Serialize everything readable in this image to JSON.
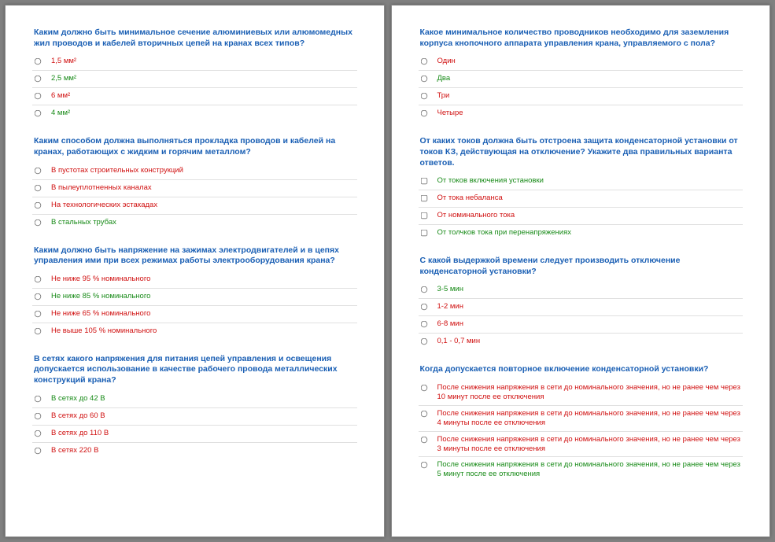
{
  "pages": [
    {
      "questions": [
        {
          "text": "Каким должно быть минимальное сечение алюминиевых или алюмомедных жил проводов и кабелей вторичных цепей на кранах всех типов?",
          "type": "radio",
          "options": [
            {
              "text": "1,5 мм²",
              "status": "wrong"
            },
            {
              "text": "2,5 мм²",
              "status": "correct"
            },
            {
              "text": "6 мм²",
              "status": "wrong"
            },
            {
              "text": "4 мм²",
              "status": "correct"
            }
          ]
        },
        {
          "text": "Каким способом должна выполняться прокладка проводов и кабелей на кранах, работающих с жидким и горячим металлом?",
          "type": "radio",
          "options": [
            {
              "text": "В пустотах строительных конструкций",
              "status": "wrong"
            },
            {
              "text": "В пылеуплотненных каналах",
              "status": "wrong"
            },
            {
              "text": "На технологических эстакадах",
              "status": "wrong"
            },
            {
              "text": "В стальных трубах",
              "status": "correct"
            }
          ]
        },
        {
          "text": "Каким должно быть напряжение на зажимах электродвигателей и в цепях управления ими при всех режимах работы электрооборудования крана?",
          "type": "radio",
          "options": [
            {
              "text": "Не ниже 95 % номинального",
              "status": "wrong"
            },
            {
              "text": "Не ниже 85 % номинального",
              "status": "correct"
            },
            {
              "text": "Не ниже 65 % номинального",
              "status": "wrong"
            },
            {
              "text": "Не выше 105 % номинального",
              "status": "wrong"
            }
          ]
        },
        {
          "text": "В сетях какого напряжения для питания цепей управления и освещения допускается использование в качестве рабочего провода металлических конструкций крана?",
          "type": "radio",
          "options": [
            {
              "text": "В сетях до 42 В",
              "status": "correct"
            },
            {
              "text": "В сетях до 60 В",
              "status": "wrong"
            },
            {
              "text": "В сетях до 110 В",
              "status": "wrong"
            },
            {
              "text": "В сетях 220 В",
              "status": "wrong"
            }
          ]
        }
      ]
    },
    {
      "questions": [
        {
          "text": "Какое минимальное количество проводников необходимо для заземления корпуса кнопочного аппарата управления крана, управляемого с пола?",
          "type": "radio",
          "options": [
            {
              "text": "Один",
              "status": "wrong"
            },
            {
              "text": "Два",
              "status": "correct"
            },
            {
              "text": "Три",
              "status": "wrong"
            },
            {
              "text": "Четыре",
              "status": "wrong"
            }
          ]
        },
        {
          "text": "От каких токов должна быть отстроена защита конденсаторной установки от токов КЗ, действующая на отключение? Укажите два правильных варианта ответов.",
          "type": "checkbox",
          "options": [
            {
              "text": "От токов включения установки",
              "status": "correct"
            },
            {
              "text": "От тока небаланса",
              "status": "wrong"
            },
            {
              "text": "От номинального тока",
              "status": "wrong"
            },
            {
              "text": "От толчков тока при перенапряжениях",
              "status": "correct"
            }
          ]
        },
        {
          "text": "С какой выдержкой времени следует производить отключение конденсаторной установки?",
          "type": "radio",
          "options": [
            {
              "text": "3-5 мин",
              "status": "correct"
            },
            {
              "text": "1-2 мин",
              "status": "wrong"
            },
            {
              "text": "6-8 мин",
              "status": "wrong"
            },
            {
              "text": "0,1 - 0,7 мин",
              "status": "wrong"
            }
          ]
        },
        {
          "text": "Когда допускается повторное включение конденсаторной установки?",
          "type": "radio",
          "options": [
            {
              "text": "После снижения напряжения  в сети до номинального  значения, но не ранее чем через 10 минут после ее отключения",
              "status": "wrong"
            },
            {
              "text": "После снижения напряжения  в сети до номинального  значения, но не ранее чем через 4 минуты после ее отключения",
              "status": "wrong"
            },
            {
              "text": "После снижения напряжения  в сети до номинального  значения, но не ранее чем через 3 минуты после ее отключения",
              "status": "wrong"
            },
            {
              "text": "После снижения напряжения  в сети до номинального  значения, но не ранее чем через 5 минут после ее отключения",
              "status": "correct"
            }
          ]
        }
      ]
    }
  ]
}
